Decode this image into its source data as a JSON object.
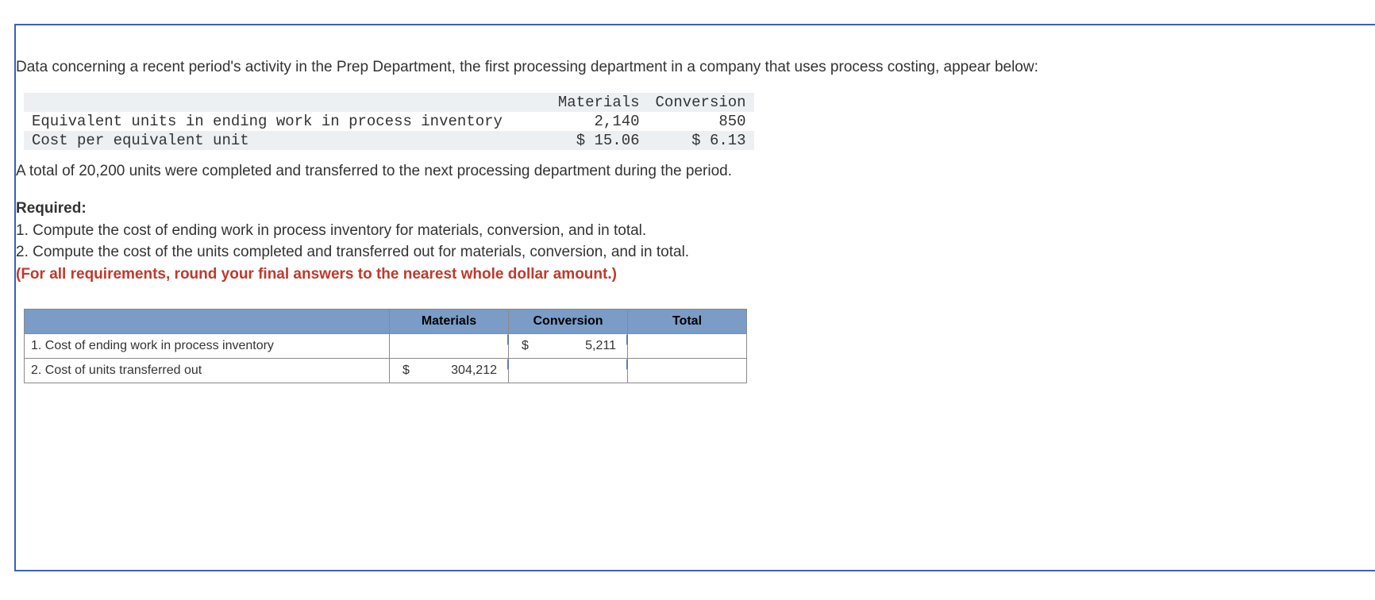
{
  "intro": "Data concerning a recent period's activity in the Prep Department, the first processing department in a company that uses process costing, appear below:",
  "info_table": {
    "headers": {
      "blank": "",
      "materials": "Materials",
      "conversion": "Conversion"
    },
    "rows": [
      {
        "label": "Equivalent units in ending work in process inventory",
        "materials": "2,140",
        "conversion": "850"
      },
      {
        "label": "Cost per equivalent unit",
        "materials": "$ 15.06",
        "conversion": "$ 6.13"
      }
    ]
  },
  "mid": "A total of 20,200 units were completed and transferred to the next processing department during the period.",
  "required": {
    "heading": "Required:",
    "item1": "1. Compute the cost of ending work in process inventory for materials, conversion, and in total.",
    "item2": "2. Compute the cost of the units completed and transferred out for materials, conversion, and in total.",
    "note": "(For all requirements, round your final answers to the nearest whole dollar amount.)"
  },
  "answer": {
    "headers": {
      "materials": "Materials",
      "conversion": "Conversion",
      "total": "Total"
    },
    "row1": {
      "label": "1. Cost of ending work in process inventory",
      "materials": "",
      "conversion_sym": "$",
      "conversion_val": "5,211",
      "total": ""
    },
    "row2": {
      "label": "2. Cost of units transferred out",
      "materials_sym": "$",
      "materials_val": "304,212",
      "conversion": "",
      "total": ""
    }
  }
}
